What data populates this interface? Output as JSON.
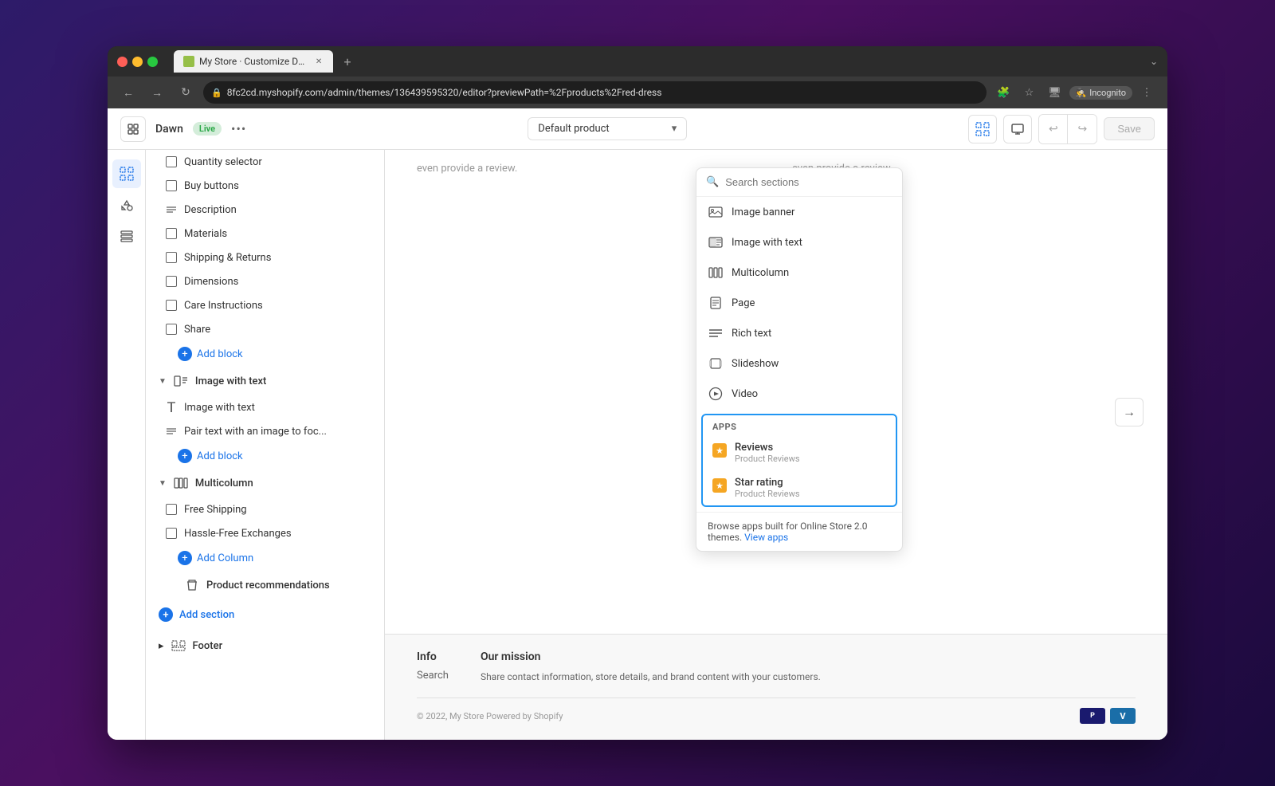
{
  "browser": {
    "tab_title": "My Store · Customize Dawn · S",
    "tab_new_label": "+",
    "address": "8fc2cd.myshopify.com/admin/themes/136439595320/editor?previewPath=%2Fproducts%2Fred-dress",
    "incognito_label": "Incognito",
    "nav": {
      "back": "←",
      "forward": "→",
      "refresh": "↻"
    }
  },
  "toolbar": {
    "theme_name": "Dawn",
    "live_badge": "Live",
    "more_label": "•••",
    "template_label": "Default product",
    "save_label": "Save",
    "undo": "↩",
    "redo": "↪"
  },
  "left_panel": {
    "items": [
      {
        "label": "Quantity selector",
        "type": "corner"
      },
      {
        "label": "Buy buttons",
        "type": "corner"
      },
      {
        "label": "Description",
        "type": "lines"
      },
      {
        "label": "Materials",
        "type": "corner"
      },
      {
        "label": "Shipping & Returns",
        "type": "corner"
      },
      {
        "label": "Dimensions",
        "type": "corner"
      },
      {
        "label": "Care Instructions",
        "type": "corner"
      },
      {
        "label": "Share",
        "type": "corner"
      }
    ],
    "add_block_1": "Add block",
    "sections": [
      {
        "label": "Image with text",
        "icon": "image-text",
        "children": [
          {
            "label": "Image with text",
            "type": "text"
          },
          {
            "label": "Pair text with an image to foc...",
            "type": "lines"
          }
        ],
        "add_block": "Add block"
      },
      {
        "label": "Multicolumn",
        "icon": "multicolumn",
        "children": [
          {
            "label": "Free Shipping",
            "type": "corner"
          },
          {
            "label": "Hassle-Free Exchanges",
            "type": "corner"
          }
        ],
        "add_block": "Add Column"
      }
    ],
    "product_recommendations": "Product recommendations",
    "add_section": "Add section",
    "footer": "Footer"
  },
  "dropdown": {
    "search_placeholder": "Search sections",
    "items": [
      {
        "label": "Image banner",
        "icon": "image-banner"
      },
      {
        "label": "Image with text",
        "icon": "image-text"
      },
      {
        "label": "Multicolumn",
        "icon": "multicolumn"
      },
      {
        "label": "Page",
        "icon": "page"
      },
      {
        "label": "Rich text",
        "icon": "rich-text"
      },
      {
        "label": "Slideshow",
        "icon": "slideshow"
      },
      {
        "label": "Video",
        "icon": "video"
      }
    ],
    "apps_label": "APPS",
    "apps": [
      {
        "name": "Reviews",
        "sub": "Product Reviews"
      },
      {
        "name": "Star rating",
        "sub": "Product Reviews"
      }
    ],
    "browse_text": "Browse apps built for Online Store 2.0 themes.",
    "view_apps": "View apps"
  },
  "preview": {
    "review_text_left": "even provide a review.",
    "review_text_right": "even provide a review.",
    "footer": {
      "info_title": "Info",
      "info_item": "Search",
      "mission_title": "Our mission",
      "mission_text": "Share contact information, store details, and brand content with your customers.",
      "copyright": "© 2022, My Store Powered by Shopify"
    }
  }
}
